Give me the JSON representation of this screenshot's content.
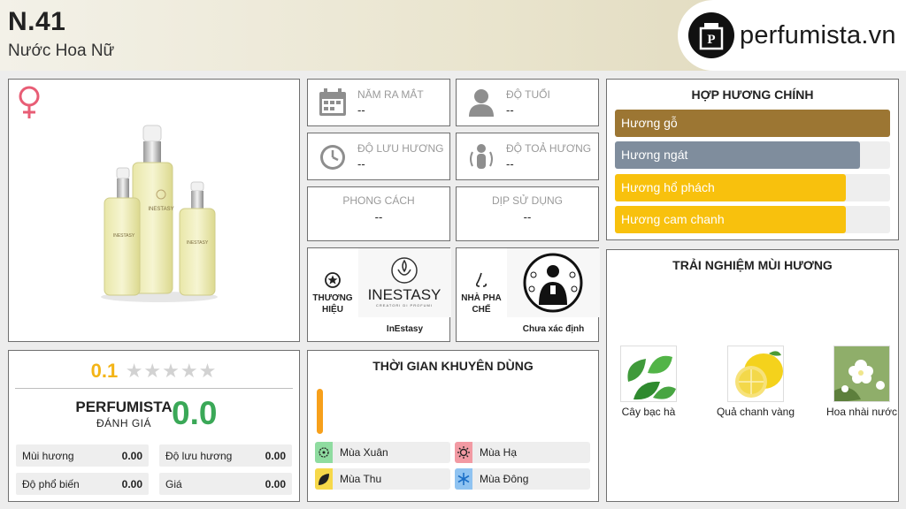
{
  "header": {
    "title": "N.41",
    "subtitle": "Nước Hoa Nữ",
    "logo_text": "perfumista.vn"
  },
  "info": {
    "release_year": {
      "label": "NĂM RA MẮT",
      "value": "--"
    },
    "age": {
      "label": "ĐỘ TUỔI",
      "value": "--"
    },
    "longevity": {
      "label": "ĐỘ LƯU HƯƠNG",
      "value": "--"
    },
    "sillage": {
      "label": "ĐỘ TOẢ HƯƠNG",
      "value": "--"
    },
    "style": {
      "label": "PHONG CÁCH",
      "value": "--"
    },
    "occasion": {
      "label": "DỊP SỬ DỤNG",
      "value": "--"
    },
    "brand": {
      "label": "THƯƠNG HIỆU",
      "name": "InEstasy",
      "logo_word": "INESTASY",
      "logo_sub": "CREATORI DI PROFUMI"
    },
    "perfumer": {
      "label": "NHÀ PHA CHẾ",
      "name": "Chưa xác định"
    }
  },
  "product": {
    "bottle_brand": "INESTASY"
  },
  "accords": {
    "title": "HỢP HƯƠNG CHÍNH",
    "items": [
      {
        "label": "Hương gỗ",
        "level": 1.0,
        "color": "#9c7633"
      },
      {
        "label": "Hương ngát",
        "level": 0.89,
        "color": "#7f8d9d"
      },
      {
        "label": "Hương hổ phách",
        "level": 0.84,
        "color": "#f8c10d"
      },
      {
        "label": "Hương cam chanh",
        "level": 0.84,
        "color": "#f8c10d"
      }
    ]
  },
  "experience": {
    "title": "TRẢI NGHIỆM MÙI HƯƠNG",
    "notes": [
      {
        "label": "Cây bạc hà"
      },
      {
        "label": "Quả chanh vàng"
      },
      {
        "label": "Hoa nhài nước"
      }
    ]
  },
  "rating": {
    "user_score": "0.1",
    "stars_filled": 0,
    "stars_total": 5,
    "pf_name": "PERFUMISTA",
    "pf_sub": "ĐÁNH GIÁ",
    "pf_score": "0.0",
    "criteria": [
      {
        "name": "Mùi hương",
        "value": "0.00"
      },
      {
        "name": "Độ lưu hương",
        "value": "0.00"
      },
      {
        "name": "Độ phổ biến",
        "value": "0.00"
      },
      {
        "name": "Giá",
        "value": "0.00"
      }
    ]
  },
  "time": {
    "title": "THỜI GIAN KHUYÊN DÙNG",
    "seasons": [
      {
        "label": "Mùa Xuân",
        "color": "#8fdca0"
      },
      {
        "label": "Mùa Hạ",
        "color": "#f29aa3"
      },
      {
        "label": "Mùa Thu",
        "color": "#f6d84a"
      },
      {
        "label": "Mùa Đông",
        "color": "#8fc3f1"
      }
    ]
  },
  "colors": {
    "accent_yellow": "#f3b416",
    "score_green": "#3aa857",
    "gender_pink": "#e85d75"
  }
}
